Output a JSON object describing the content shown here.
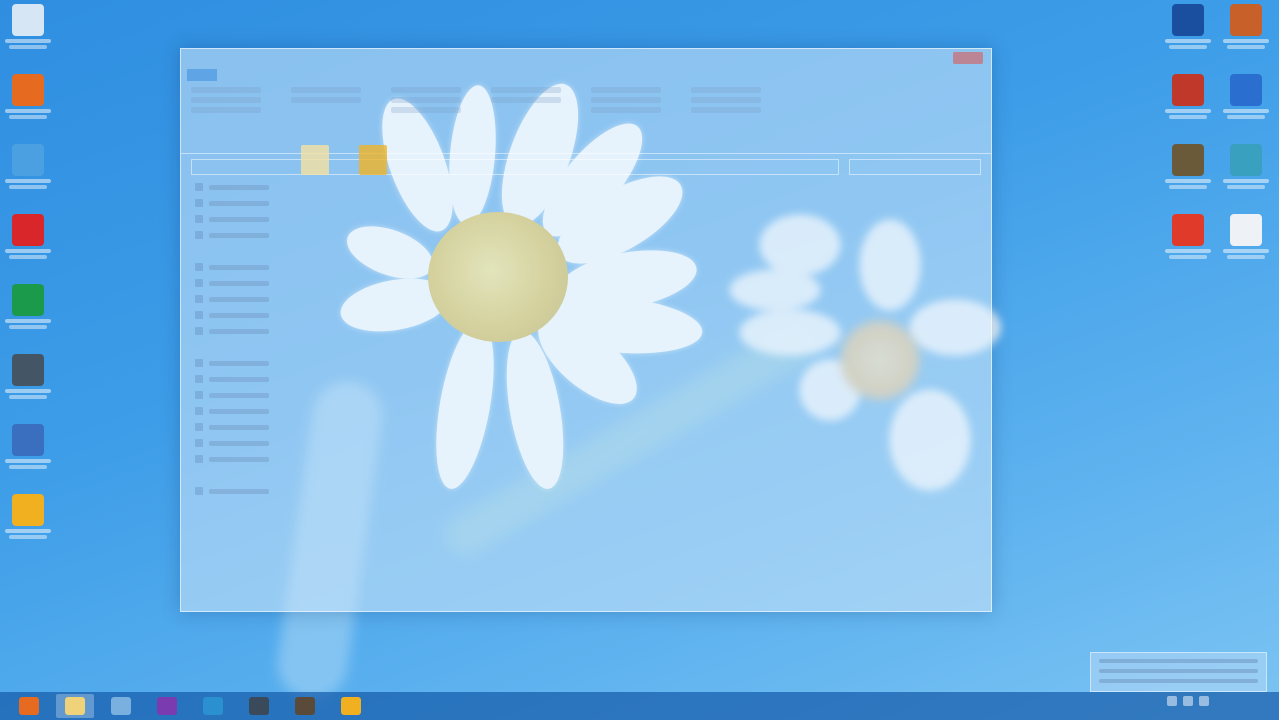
{
  "desktop": {
    "left_icons": [
      {
        "name": "recycle-bin-icon",
        "color": "#d6e6f5"
      },
      {
        "name": "firefox-icon",
        "color": "#e66a1f"
      },
      {
        "name": "network-globe-icon",
        "color": "#4aa0e0"
      },
      {
        "name": "kaspersky-icon",
        "color": "#d8262a"
      },
      {
        "name": "green-app-icon",
        "color": "#1a9a4a"
      },
      {
        "name": "display-app-icon",
        "color": "#445566"
      },
      {
        "name": "folder-app-icon",
        "color": "#3a6fc0"
      },
      {
        "name": "yellow-app-icon",
        "color": "#f0b020"
      }
    ],
    "right_icons": [
      {
        "name": "pdf-app-icon",
        "color": "#1a4fa0"
      },
      {
        "name": "colorful-ball-icon",
        "color": "#c8602a"
      },
      {
        "name": "red-app-icon",
        "color": "#c0382a"
      },
      {
        "name": "info-icon",
        "color": "#2a6fd0"
      },
      {
        "name": "gear-app-icon",
        "color": "#6a5a3a"
      },
      {
        "name": "globe-network-icon",
        "color": "#3aa0c0"
      },
      {
        "name": "red-circle-icon",
        "color": "#e03a2a"
      },
      {
        "name": "document-icon",
        "color": "#eef2f7"
      }
    ]
  },
  "taskbar": {
    "apps": [
      {
        "name": "firefox-taskbar-icon",
        "color": "#e66a1f",
        "active": false
      },
      {
        "name": "file-explorer-taskbar-icon",
        "color": "#f0d27a",
        "active": true
      },
      {
        "name": "network-taskbar-icon",
        "color": "#7ab0e0",
        "active": false
      },
      {
        "name": "visual-studio-taskbar-icon",
        "color": "#7a3ab0",
        "active": false
      },
      {
        "name": "globe-taskbar-icon",
        "color": "#2a90d0",
        "active": false
      },
      {
        "name": "eye-app-taskbar-icon",
        "color": "#3a4a5a",
        "active": false
      },
      {
        "name": "mask-app-taskbar-icon",
        "color": "#5a4a3a",
        "active": false
      },
      {
        "name": "yellow-app-taskbar-icon",
        "color": "#f0b020",
        "active": false
      }
    ]
  },
  "colors": {
    "wallpaper": "#3d9de8",
    "taskbar": "#145aa8",
    "daisy_center": "#d8b730"
  }
}
